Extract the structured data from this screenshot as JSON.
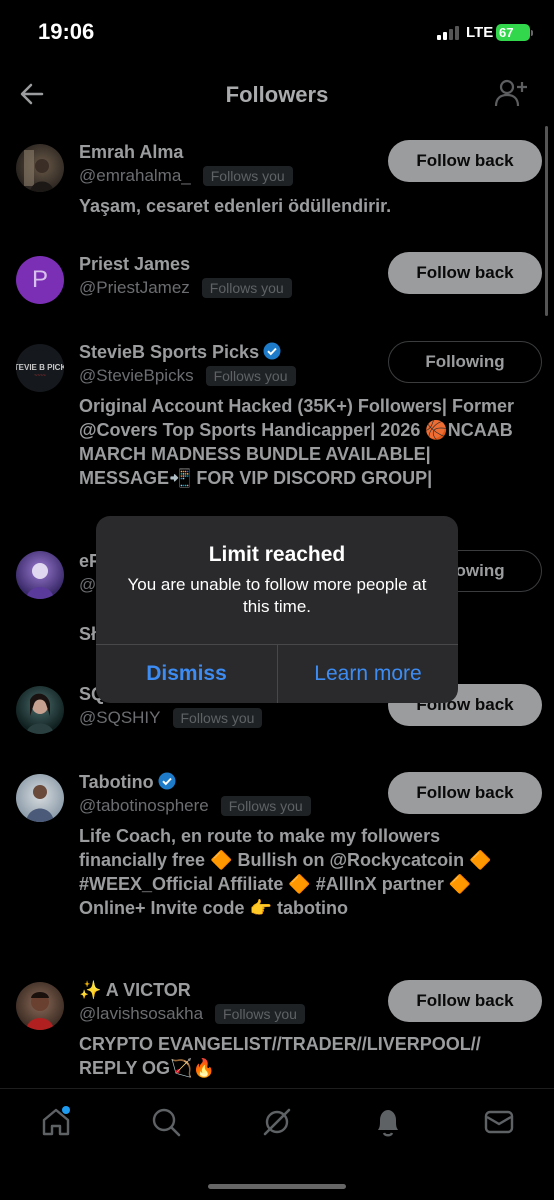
{
  "status": {
    "time": "19:06",
    "network": "LTE",
    "battery": "67"
  },
  "header": {
    "title": "Followers"
  },
  "followers": [
    {
      "name": "Emrah Alma",
      "handle": "@emrahalma_",
      "follows_you": "Follows you",
      "button": "Follow back",
      "bio": "Yaşam, cesaret edenleri ödüllendirir."
    },
    {
      "name": "Priest James",
      "handle": "@PriestJamez",
      "follows_you": "Follows you",
      "button": "Follow back",
      "avatar_letter": "P"
    },
    {
      "name": "StevieB Sports Picks",
      "handle": "@StevieBpicks",
      "follows_you": "Follows you",
      "button": "Following",
      "verified": true,
      "bio": "Original Account Hacked (35K+) Followers| Former @Covers Top Sports Handicapper| 2026 🏀NCAAB MARCH MADNESS BUNDLE AVAILABLE| MESSAGE📲 FOR VIP DISCORD GROUP|"
    },
    {
      "name": "eF",
      "handle": "@",
      "button": "Following",
      "bio": "Sł"
    },
    {
      "name": "SQ",
      "handle": "@SQSHIY",
      "follows_you": "Follows you",
      "button": "Follow back"
    },
    {
      "name": "Tabotino",
      "handle": "@tabotinosphere",
      "follows_you": "Follows you",
      "button": "Follow back",
      "verified": true,
      "bio": "Life Coach, en route to make my followers financially free 🔶 Bullish on @Rockycatcoin 🔶 #WEEX_Official Affiliate 🔶 #AllInX partner 🔶  Online+ Invite code 👉 tabotino"
    },
    {
      "name": "✨ A VICTOR",
      "handle": "@lavishsosakha",
      "follows_you": "Follows you",
      "button": "Follow back",
      "bio": "CRYPTO EVANGELIST//TRADER//LIVERPOOL// REPLY OG🏹🔥"
    }
  ],
  "alert": {
    "title": "Limit reached",
    "message": "You are unable to follow more people at this time.",
    "dismiss": "Dismiss",
    "learn_more": "Learn more"
  },
  "colors": {
    "accent": "#3d8cf3",
    "verified": "#1d9bf0",
    "battery": "#32d74b"
  },
  "tabs": [
    "home-icon",
    "search-icon",
    "grok-icon",
    "notifications-icon",
    "messages-icon"
  ]
}
